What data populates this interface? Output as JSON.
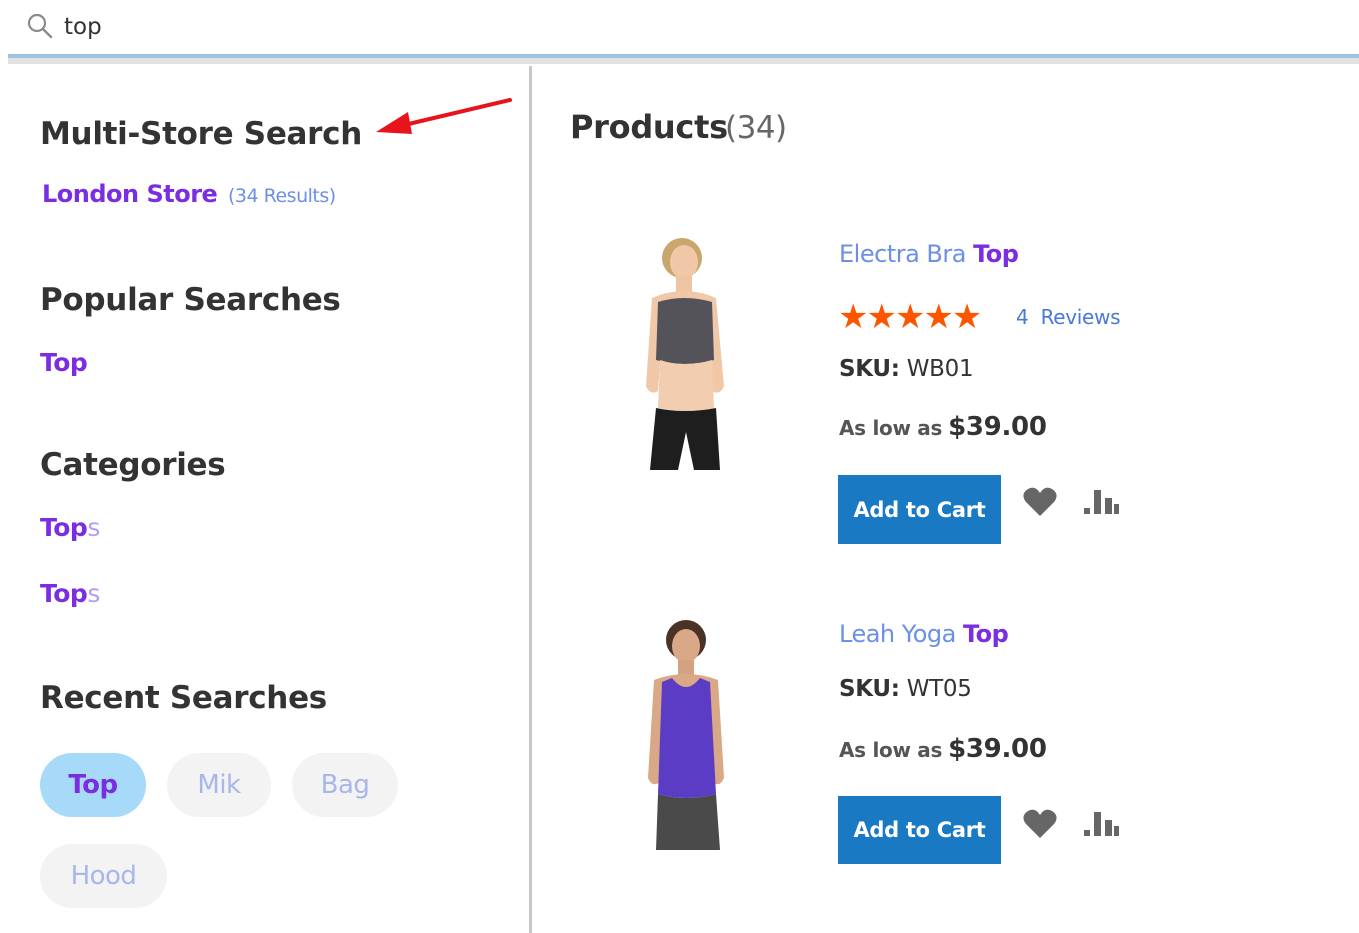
{
  "search": {
    "value": "top"
  },
  "left": {
    "multistore_title": "Multi-Store Search",
    "store_name": "London Store",
    "store_count": "(34 Results)",
    "popular_title": "Popular Searches",
    "popular_items": [
      {
        "bold": "Top",
        "rest": ""
      }
    ],
    "categories_title": "Categories",
    "categories": [
      {
        "bold": "Top",
        "rest": "s"
      },
      {
        "bold": "Top",
        "rest": "s"
      }
    ],
    "recent_title": "Recent Searches",
    "recent": [
      "Top",
      "Mik",
      "Bag",
      "Hood"
    ]
  },
  "right": {
    "title": "Products",
    "count": "(34)",
    "products": [
      {
        "name_prefix": "Electra Bra ",
        "name_highlight": "Top",
        "rating": 5,
        "stars": "★★★★★",
        "reviews_count": "4",
        "reviews_label": "Reviews",
        "sku_label": "SKU:",
        "sku": "WB01",
        "price_label": "As low as",
        "price": "$39.00",
        "button": "Add to Cart"
      },
      {
        "name_prefix": "Leah Yoga ",
        "name_highlight": "Top",
        "sku_label": "SKU:",
        "sku": "WT05",
        "price_label": "As low as",
        "price": "$39.00",
        "button": "Add to Cart"
      }
    ]
  },
  "colors": {
    "accent_purple": "#7a2ee0",
    "link_blue": "#6c8fe8",
    "button_blue": "#1979c3",
    "star_orange": "#ff5501",
    "active_pill": "#a7daf9",
    "annotation_red": "#e8141b"
  },
  "icons": [
    "search-icon",
    "heart-icon",
    "compare-icon",
    "annotation-arrow"
  ]
}
